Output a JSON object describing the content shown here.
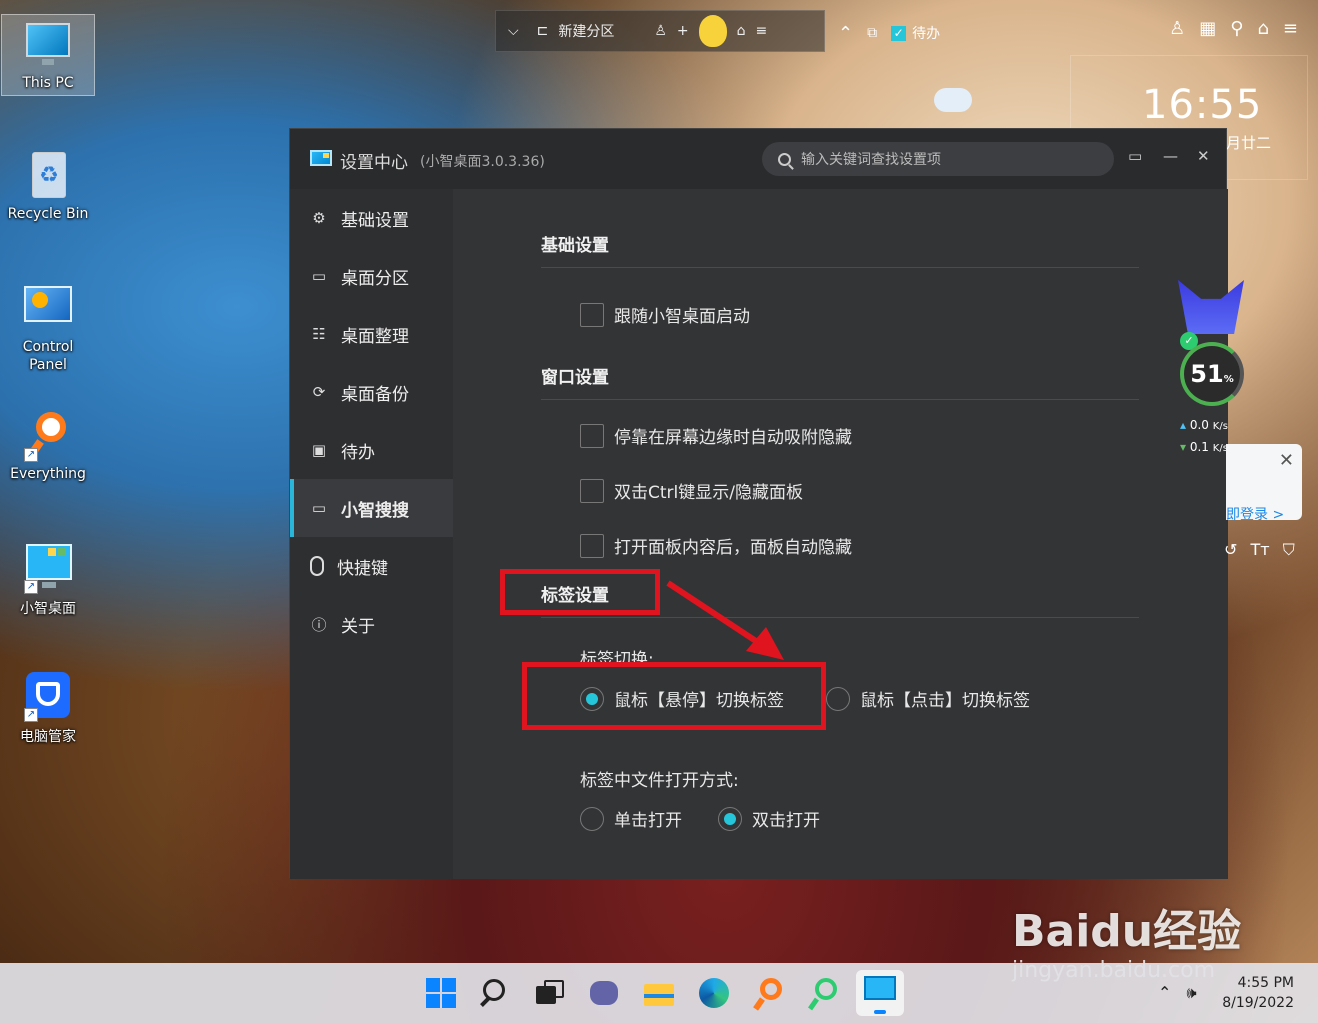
{
  "desktop": {
    "icons": [
      {
        "label": "This PC",
        "icon": "monitor-icon"
      },
      {
        "label": "Recycle Bin",
        "icon": "recycle-bin-icon"
      },
      {
        "label": "Control\nPanel",
        "icon": "control-panel-icon"
      },
      {
        "label": "Everything",
        "icon": "search-magnifier-icon"
      },
      {
        "label": "小智桌面",
        "icon": "xiaozhi-desktop-icon"
      },
      {
        "label": "电脑管家",
        "icon": "shield-icon"
      }
    ]
  },
  "topbar": {
    "partition_label": "新建分区",
    "todo_label": "待办"
  },
  "clock": {
    "time": "16:55",
    "date": "月廿二"
  },
  "window": {
    "title": "设置中心",
    "version": "(小智桌面3.0.3.36)",
    "search_placeholder": "输入关键词查找设置项",
    "nav": [
      {
        "label": "基础设置",
        "icon": "gear-icon"
      },
      {
        "label": "桌面分区",
        "icon": "monitor-icon"
      },
      {
        "label": "桌面整理",
        "icon": "list-icon"
      },
      {
        "label": "桌面备份",
        "icon": "sync-icon"
      },
      {
        "label": "待办",
        "icon": "calendar-icon"
      },
      {
        "label": "小智搜搜",
        "icon": "window-icon"
      },
      {
        "label": "快捷键",
        "icon": "mouse-icon"
      },
      {
        "label": "关于",
        "icon": "info-icon"
      }
    ],
    "active_nav": "小智搜搜",
    "sections": {
      "basic": {
        "title": "基础设置",
        "options": [
          {
            "label": "跟随小智桌面启动",
            "checked": false
          }
        ]
      },
      "window": {
        "title": "窗口设置",
        "options": [
          {
            "label": "停靠在屏幕边缘时自动吸附隐藏",
            "checked": false
          },
          {
            "label": "双击Ctrl键显示/隐藏面板",
            "checked": false
          },
          {
            "label": "打开面板内容后，面板自动隐藏",
            "checked": false
          }
        ]
      },
      "tabs": {
        "title": "标签设置",
        "switch_label": "标签切换:",
        "switch_options": [
          {
            "label": "鼠标【悬停】切换标签",
            "selected": true
          },
          {
            "label": "鼠标【点击】切换标签",
            "selected": false
          }
        ],
        "open_label": "标签中文件打开方式:",
        "open_options": [
          {
            "label": "单击打开",
            "selected": false
          },
          {
            "label": "双击打开",
            "selected": true
          }
        ]
      }
    }
  },
  "monitor_widget": {
    "percent": "51",
    "percent_unit": "%",
    "up": "0.0",
    "down": "0.1",
    "unit": "K/s"
  },
  "popup": {
    "link": "即登录 >"
  },
  "tray": {
    "time": "4:55 PM",
    "date": "8/19/2022"
  },
  "watermark": {
    "brand": "Baidu经验",
    "url": "jingyan.baidu.com"
  },
  "accent_color": "#26c6da",
  "annotation_color": "#e0141e"
}
